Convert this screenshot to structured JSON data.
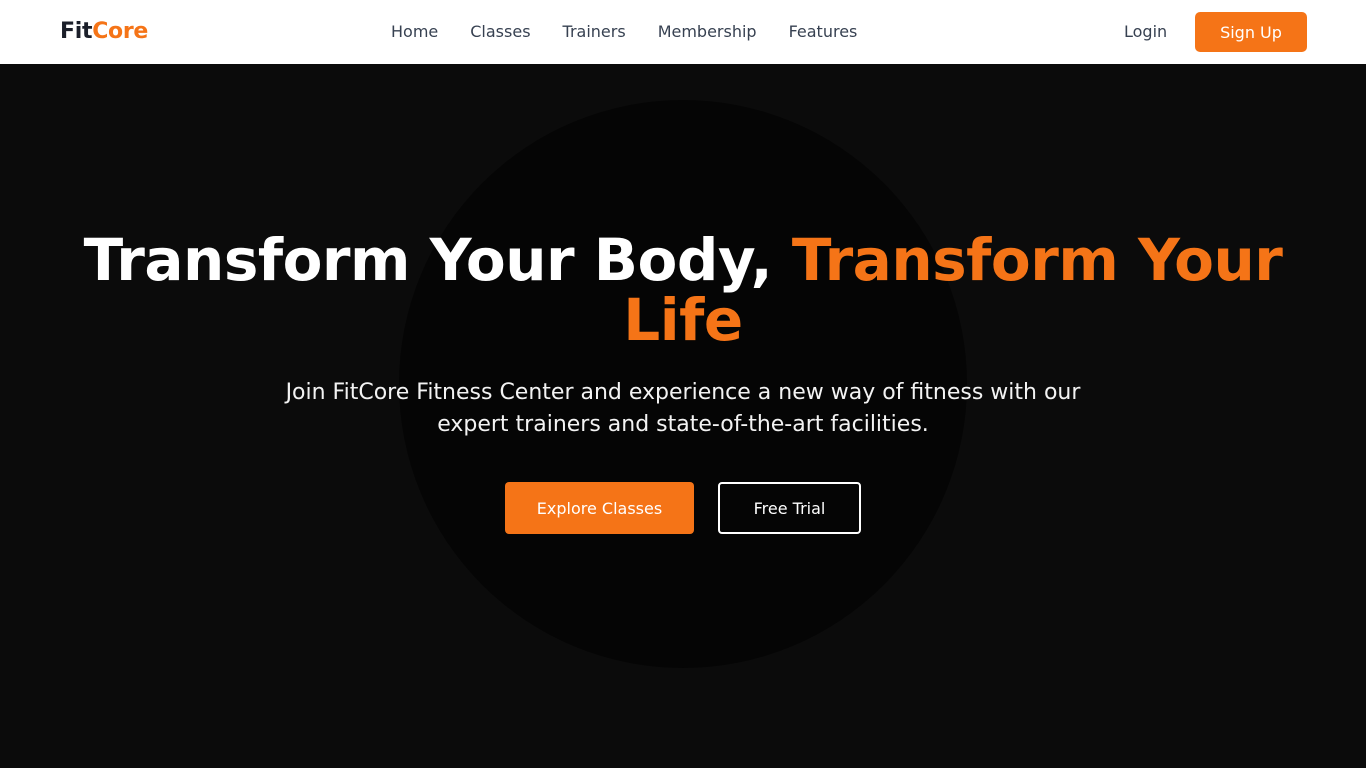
{
  "brand": {
    "name_part1": "Fit",
    "name_part2": "Core",
    "accent_color": "#f57417"
  },
  "nav": {
    "links": [
      {
        "label": "Home"
      },
      {
        "label": "Classes"
      },
      {
        "label": "Trainers"
      },
      {
        "label": "Membership"
      },
      {
        "label": "Features"
      }
    ],
    "login_label": "Login",
    "signup_label": "Sign Up"
  },
  "hero": {
    "title_white": "Transform Your Body, ",
    "title_accent": "Transform Your Life",
    "subtitle": "Join FitCore Fitness Center and experience a new way of fitness with our expert trainers and state-of-the-art facilities.",
    "primary_cta": "Explore Classes",
    "secondary_cta": "Free Trial",
    "background_color": "#0b0b0b"
  }
}
